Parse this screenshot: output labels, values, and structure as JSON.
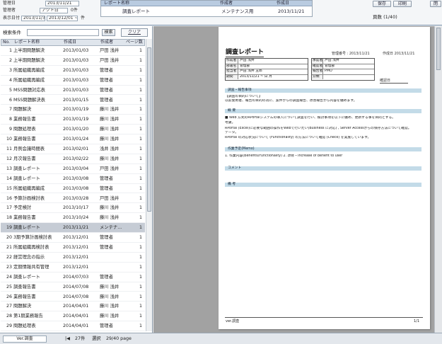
{
  "header": {
    "filter": {
      "row1_label": "管理日",
      "row1_value": "2013/11/21",
      "row2_label": "管理者",
      "row2_value": "アクト日",
      "row2_count": "0件",
      "row3_label": "表示日付",
      "row3_from": "2013/11/30",
      "row3_to": "2013/12/01 ~",
      "row3_unit": "件"
    },
    "report_table": {
      "columns": [
        "レポート名称",
        "作成者",
        "作成日"
      ],
      "row": [
        "調査レポート",
        "メンテナンス用",
        "2013/11/21"
      ]
    },
    "buttons": {
      "save": "保存",
      "print": "印刷",
      "close": "閉"
    },
    "page_info": "頁数 (1/40)"
  },
  "search": {
    "label": "検索条件",
    "value": "",
    "button": "検索",
    "clear": "クリア"
  },
  "list": {
    "columns": [
      "No.",
      "レポート名称",
      "作成日",
      "作成者",
      "ページ数"
    ],
    "selected_no": 19,
    "rows": [
      [
        "1",
        "上半期問題解決",
        "2013/01/03",
        "戸田 浅井",
        "1"
      ],
      [
        "2",
        "上半期問題解決",
        "2013/01/03",
        "戸田 浅井",
        "1"
      ],
      [
        "3",
        "所属組織再編成",
        "2013/01/03",
        "管理者",
        "1"
      ],
      [
        "4",
        "所属組織再編成",
        "2013/01/03",
        "管理者",
        "1"
      ],
      [
        "5",
        "MSS問題対応表",
        "2013/01/03",
        "管理者",
        "1"
      ],
      [
        "6",
        "MSS問題解決表",
        "2013/01/15",
        "管理者",
        "1"
      ],
      [
        "7",
        "問題解決",
        "2013/01/19",
        "藤川 浅井",
        "1"
      ],
      [
        "8",
        "業務報告書",
        "2013/01/19",
        "藤川 浅井",
        "1"
      ],
      [
        "9",
        "問題処理表",
        "2013/01/20",
        "藤川 浅井",
        "1"
      ],
      [
        "10",
        "業務報告書",
        "2013/01/24",
        "藤川 浅井",
        "1"
      ],
      [
        "11",
        "月例会議時間表",
        "2013/02/01",
        "浅井 浅井",
        "1"
      ],
      [
        "12",
        "月次報告書",
        "2013/02/22",
        "藤川 浅井",
        "1"
      ],
      [
        "13",
        "調査レポート",
        "2013/03/04",
        "戸田 浅井",
        "1"
      ],
      [
        "14",
        "調査レポート",
        "2013/03/08",
        "管理者",
        "1"
      ],
      [
        "15",
        "所属組織再編成",
        "2013/03/08",
        "管理者",
        "1"
      ],
      [
        "16",
        "予算計画検討表",
        "2013/03/28",
        "戸田 浅井",
        "1"
      ],
      [
        "17",
        "予定検討",
        "2013/10/17",
        "藤川 浅井",
        "1"
      ],
      [
        "18",
        "業務報告書",
        "2013/10/24",
        "藤川 浅井",
        "1"
      ],
      [
        "19",
        "調査レポート",
        "2013/11/21",
        "メンテナ...",
        "1"
      ],
      [
        "20",
        "3期予算計画検討表",
        "2013/12/01",
        "管理者",
        "1"
      ],
      [
        "21",
        "所属組織再検討表",
        "2013/12/01",
        "管理者",
        "1"
      ],
      [
        "22",
        "経営理念の指示",
        "2013/12/01",
        "",
        "1"
      ],
      [
        "23",
        "定期情報共有管理",
        "2013/12/01",
        "",
        "1"
      ],
      [
        "24",
        "調査レポート",
        "2014/07/03",
        "管理者",
        "1"
      ],
      [
        "25",
        "調査報告書",
        "2014/07/08",
        "藤川 浅井",
        "1"
      ],
      [
        "26",
        "業務報告書",
        "2014/07/08",
        "藤川 浅井",
        "1"
      ],
      [
        "27",
        "問題解決",
        "2014/04/01",
        "藤川 浅井",
        "1"
      ],
      [
        "28",
        "第1期業務報告",
        "2014/04/01",
        "藤川 浅井",
        "1"
      ],
      [
        "29",
        "問題処理表",
        "2014/04/01",
        "管理者",
        "1"
      ]
    ]
  },
  "status": {
    "version": "Ver.調査",
    "nav": "|◀",
    "count": "27件",
    "select": "選択",
    "page": "29/40 page"
  },
  "doc": {
    "title": "調査レポート",
    "meta_no": "管理番号 : 2013/11/21",
    "meta_date": "作成日 2013/11/21",
    "left_grid": [
      [
        "作成者",
        "戸田 浅井"
      ],
      [
        "部署名",
        "管理部"
      ],
      [
        "担当者",
        "戸田 浅井 五郎"
      ],
      [
        "期間",
        "2013/11/21  ~  日  月"
      ]
    ],
    "right_grid": [
      [
        "承認者",
        "戸田 浅井"
      ],
      [
        "確認者",
        "管理部"
      ],
      [
        "報告者",
        "PMO"
      ],
      [
        "分類",
        ""
      ]
    ],
    "confirm_label": "確認日",
    "sections": [
      {
        "title": "調査・報告事項",
        "lines": [
          "【調査の目的について】",
          "以前使用者、報告の目的の為に、案件からの調査報告、改善報告から内容を纏めます。"
        ]
      },
      {
        "title": "概 要",
        "lines": [
          "■ Web 方式のRPortalシステムの導入について調査を行い、検討事項を以下に纏め、更新する事を目的とする。",
          "考慮。",
          "RPortal (Excel)に必要な範囲の操作をWebで行いたい(Business に対応) , Server Accessからの保存方法について確認。",
          "データ。",
          "RPortal の対応状況について (Functionality) の方法について確認 (Check) を実施しています。"
        ]
      },
      {
        "title": "作業予定(Memo)",
        "lines": [
          "1. 作業内容(Benefits/Functionality)  2. 改修・Increase of benefit to user"
        ]
      },
      {
        "title": "コメント",
        "lines": []
      },
      {
        "title": "備 考",
        "lines": []
      }
    ],
    "footer_left": "ver.調査",
    "footer_right": "1/1"
  }
}
